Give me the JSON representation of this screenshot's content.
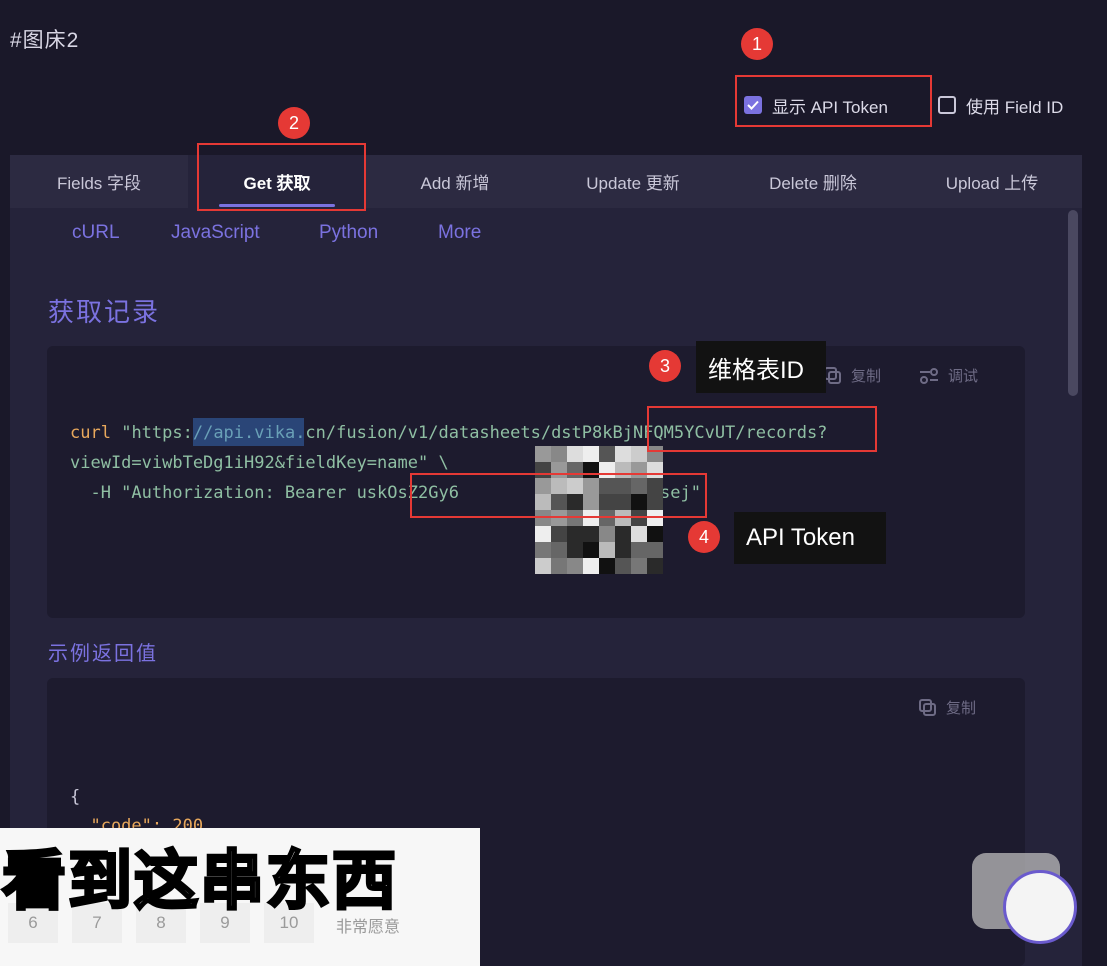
{
  "title": "#图床2",
  "checkboxes": [
    {
      "label": "显示 API Token",
      "checked": true
    },
    {
      "label": "使用 Field ID",
      "checked": false
    }
  ],
  "tabs": [
    {
      "label": "Fields 字段",
      "active": false
    },
    {
      "label": "Get 获取",
      "active": true
    },
    {
      "label": "Add 新增",
      "active": false
    },
    {
      "label": "Update 更新",
      "active": false
    },
    {
      "label": "Delete 删除",
      "active": false
    },
    {
      "label": "Upload 上传",
      "active": false
    }
  ],
  "languages": [
    "cURL",
    "JavaScript",
    "Python",
    "More"
  ],
  "section_title": "获取记录",
  "code_actions": {
    "copy": "复制",
    "debug": "调试"
  },
  "code": {
    "cmd": "curl",
    "url_line1": "\"https://api.vika.cn/fusion/v1/datasheets/dstP8kBjNFQM5YCvUT/records?",
    "url_line2": "viewId=viwbTeDg1iH92&fieldKey=name\" \\",
    "header": "  -H \"Authorization: Bearer uskOsZ2Gy6",
    "header_tail": "sej\""
  },
  "example_title": "示例返回值",
  "example_copy": "复制",
  "example_code": {
    "brace": "{",
    "line2": "  \"code\": 200"
  },
  "annotations": {
    "badge1": "1",
    "badge2": "2",
    "badge3": "3",
    "badge4": "4",
    "tooltip3": "维格表ID",
    "tooltip4": "API Token"
  },
  "subtitle": "看到这串东西",
  "rating": {
    "numbers": [
      "6",
      "7",
      "8",
      "9",
      "10"
    ],
    "label": "非常愿意"
  },
  "icons": [
    "checkbox-checked-icon",
    "checkbox-empty-icon",
    "copy-icon",
    "debug-icon",
    "tv-logo-icon"
  ],
  "colors": {
    "accent": "#7b72e0",
    "annotation_red": "#e53935",
    "background": "#1a1829"
  }
}
